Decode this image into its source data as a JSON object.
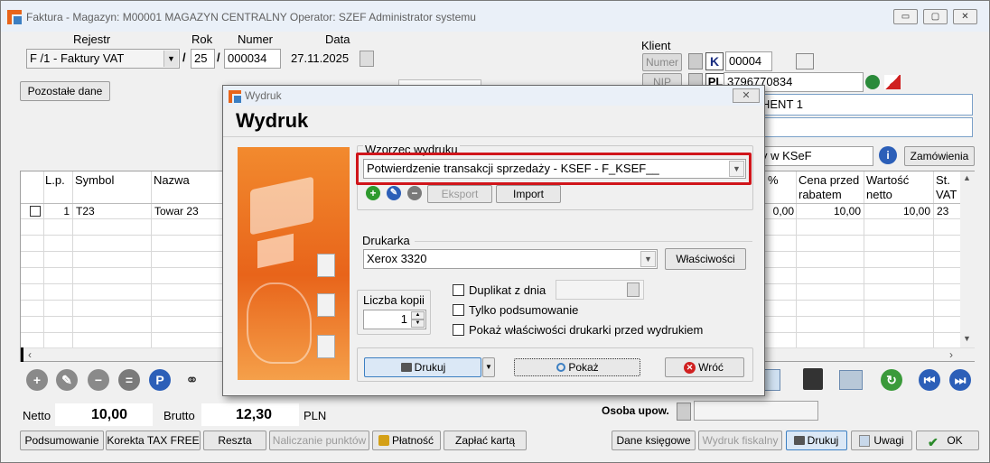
{
  "window": {
    "title": "Faktura - Magazyn: M00001 MAGAZYN CENTRALNY  Operator: SZEF Administrator systemu",
    "minimize": "▭",
    "maximize": "▢",
    "close": "✕"
  },
  "header": {
    "rejestr_label": "Rejestr",
    "rok_label": "Rok",
    "numer_label": "Numer",
    "data_label": "Data",
    "rejestr_value": "F /1   - Faktury VAT",
    "slash1": "/",
    "rok_value": "25",
    "slash2": "/",
    "numer_value": "000034",
    "data_value": "27.11.2025",
    "pozostale_button": "Pozostałe dane"
  },
  "klient": {
    "label": "Klient",
    "numer_button": "Numer",
    "nip_button": "NIP",
    "k_badge": "K",
    "numer_value": "00004",
    "pl_badge": "PL",
    "nip_value": "3796770834",
    "name_value": "HENT 1",
    "ksef_value": "y w KSeF",
    "zamowienia_button": "Zamówienia"
  },
  "grid": {
    "columns": [
      "L.p.",
      "Symbol",
      "Nazwa",
      "%",
      "Cena przed rabatem",
      "Wartość netto",
      "St. VAT"
    ],
    "cena_line1": "Cena przed",
    "cena_line2": "rabatem",
    "wartosc_line1": "Wartość",
    "wartosc_line2": "netto",
    "vat_line1": "St.",
    "vat_line2": "VAT",
    "rows": [
      {
        "lp": "1",
        "symbol": "T23",
        "nazwa": "Towar 23",
        "rabat": "0,00",
        "cena": "10,00",
        "wartosc": "10,00",
        "vat": "23"
      }
    ]
  },
  "totals": {
    "netto_label": "Netto",
    "netto_value": "10,00",
    "brutto_label": "Brutto",
    "brutto_value": "12,30",
    "currency": "PLN",
    "osoba_label": "Osoba upow."
  },
  "bottom_buttons": {
    "podsumowanie": "Podsumowanie",
    "korekta": "Korekta TAX FREE",
    "reszta": "Reszta",
    "naliczanie": "Naliczanie punktów",
    "platnosc": "Płatność",
    "zaplac": "Zapłać kartą",
    "dane_ksiegowe": "Dane księgowe",
    "wydruk_fiskalny": "Wydruk fiskalny",
    "drukuj": "Drukuj",
    "uwagi": "Uwagi",
    "ok": "OK"
  },
  "dialog": {
    "window_title": "Wydruk",
    "heading": "Wydruk",
    "wzorzec_label": "Wzorzec wydruku",
    "wzorzec_value": "Potwierdzenie transakcji sprzedaży - KSEF  -  F_KSEF__",
    "eksport_button": "Eksport",
    "import_button": "Import",
    "drukarka_label": "Drukarka",
    "drukarka_value": "Xerox 3320",
    "wlasciwosci_button": "Właściwości",
    "liczba_kopii_label": "Liczba kopii",
    "liczba_kopii_value": "1",
    "duplikat_label": "Duplikat z dnia",
    "tylko_label": "Tylko podsumowanie",
    "pokaz_wl_label": "Pokaż właściwości drukarki przed wydrukiem",
    "drukuj_button": "Drukuj",
    "pokaz_button": "Pokaż",
    "wroc_button": "Wróć",
    "highlight_color": "#d0151b",
    "accent_orange": "#e8641a"
  }
}
